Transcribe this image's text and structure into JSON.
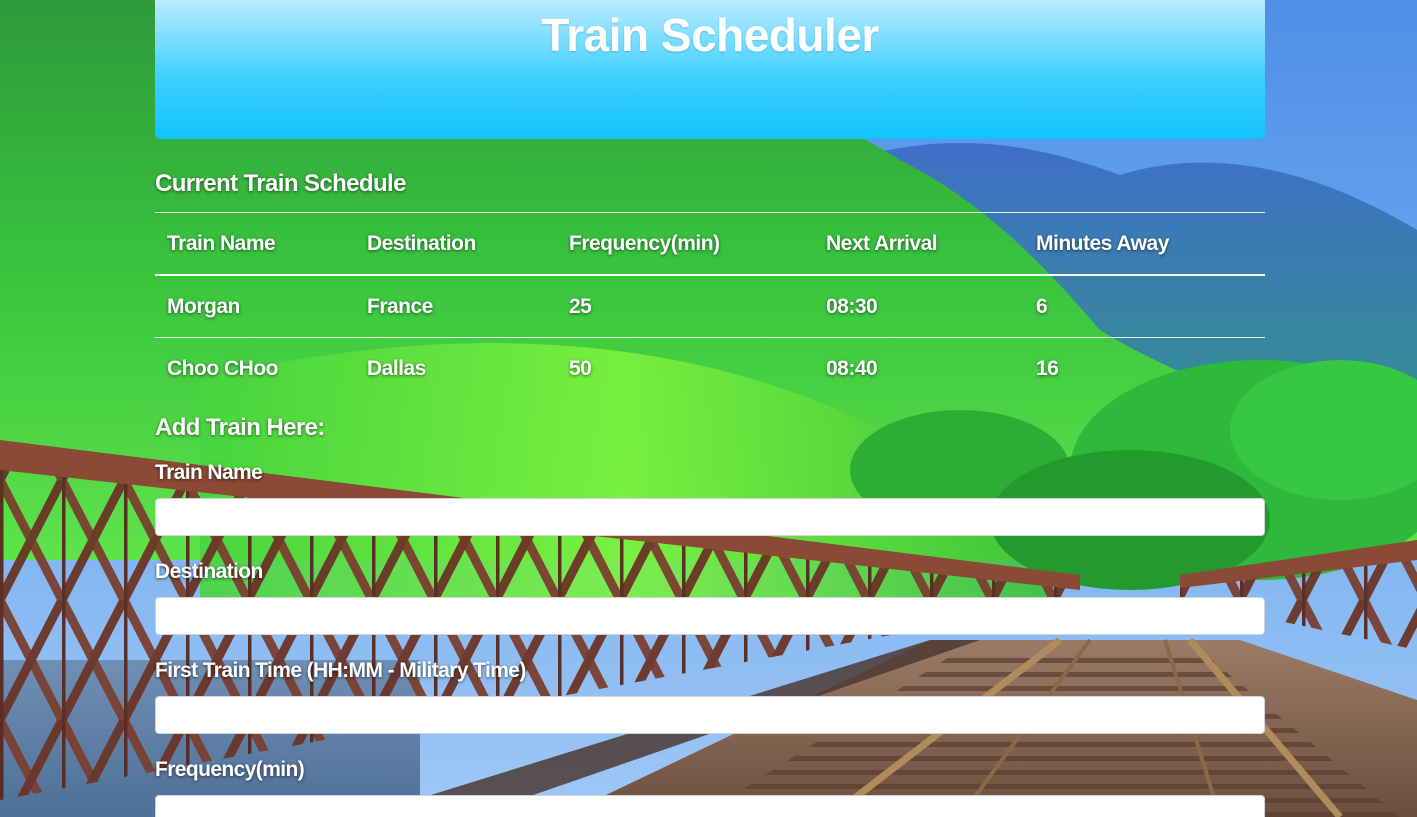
{
  "header": {
    "title": "Train Scheduler"
  },
  "schedule": {
    "title": "Current Train Schedule",
    "columns": [
      "Train Name",
      "Destination",
      "Frequency(min)",
      "Next Arrival",
      "Minutes Away"
    ],
    "rows": [
      [
        "Morgan",
        "France",
        "25",
        "08:30",
        "6"
      ],
      [
        "Choo CHoo",
        "Dallas",
        "50",
        "08:40",
        "16"
      ]
    ]
  },
  "form": {
    "title": "Add Train Here:",
    "fields": [
      {
        "label": "Train Name",
        "value": ""
      },
      {
        "label": "Destination",
        "value": ""
      },
      {
        "label": "First Train Time (HH:MM - Military Time)",
        "value": ""
      },
      {
        "label": "Frequency(min)",
        "value": ""
      }
    ]
  },
  "colors": {
    "header_gradient_top": "#b9ecff",
    "header_gradient_bottom": "#12c3ff",
    "text": "#ffffff"
  }
}
